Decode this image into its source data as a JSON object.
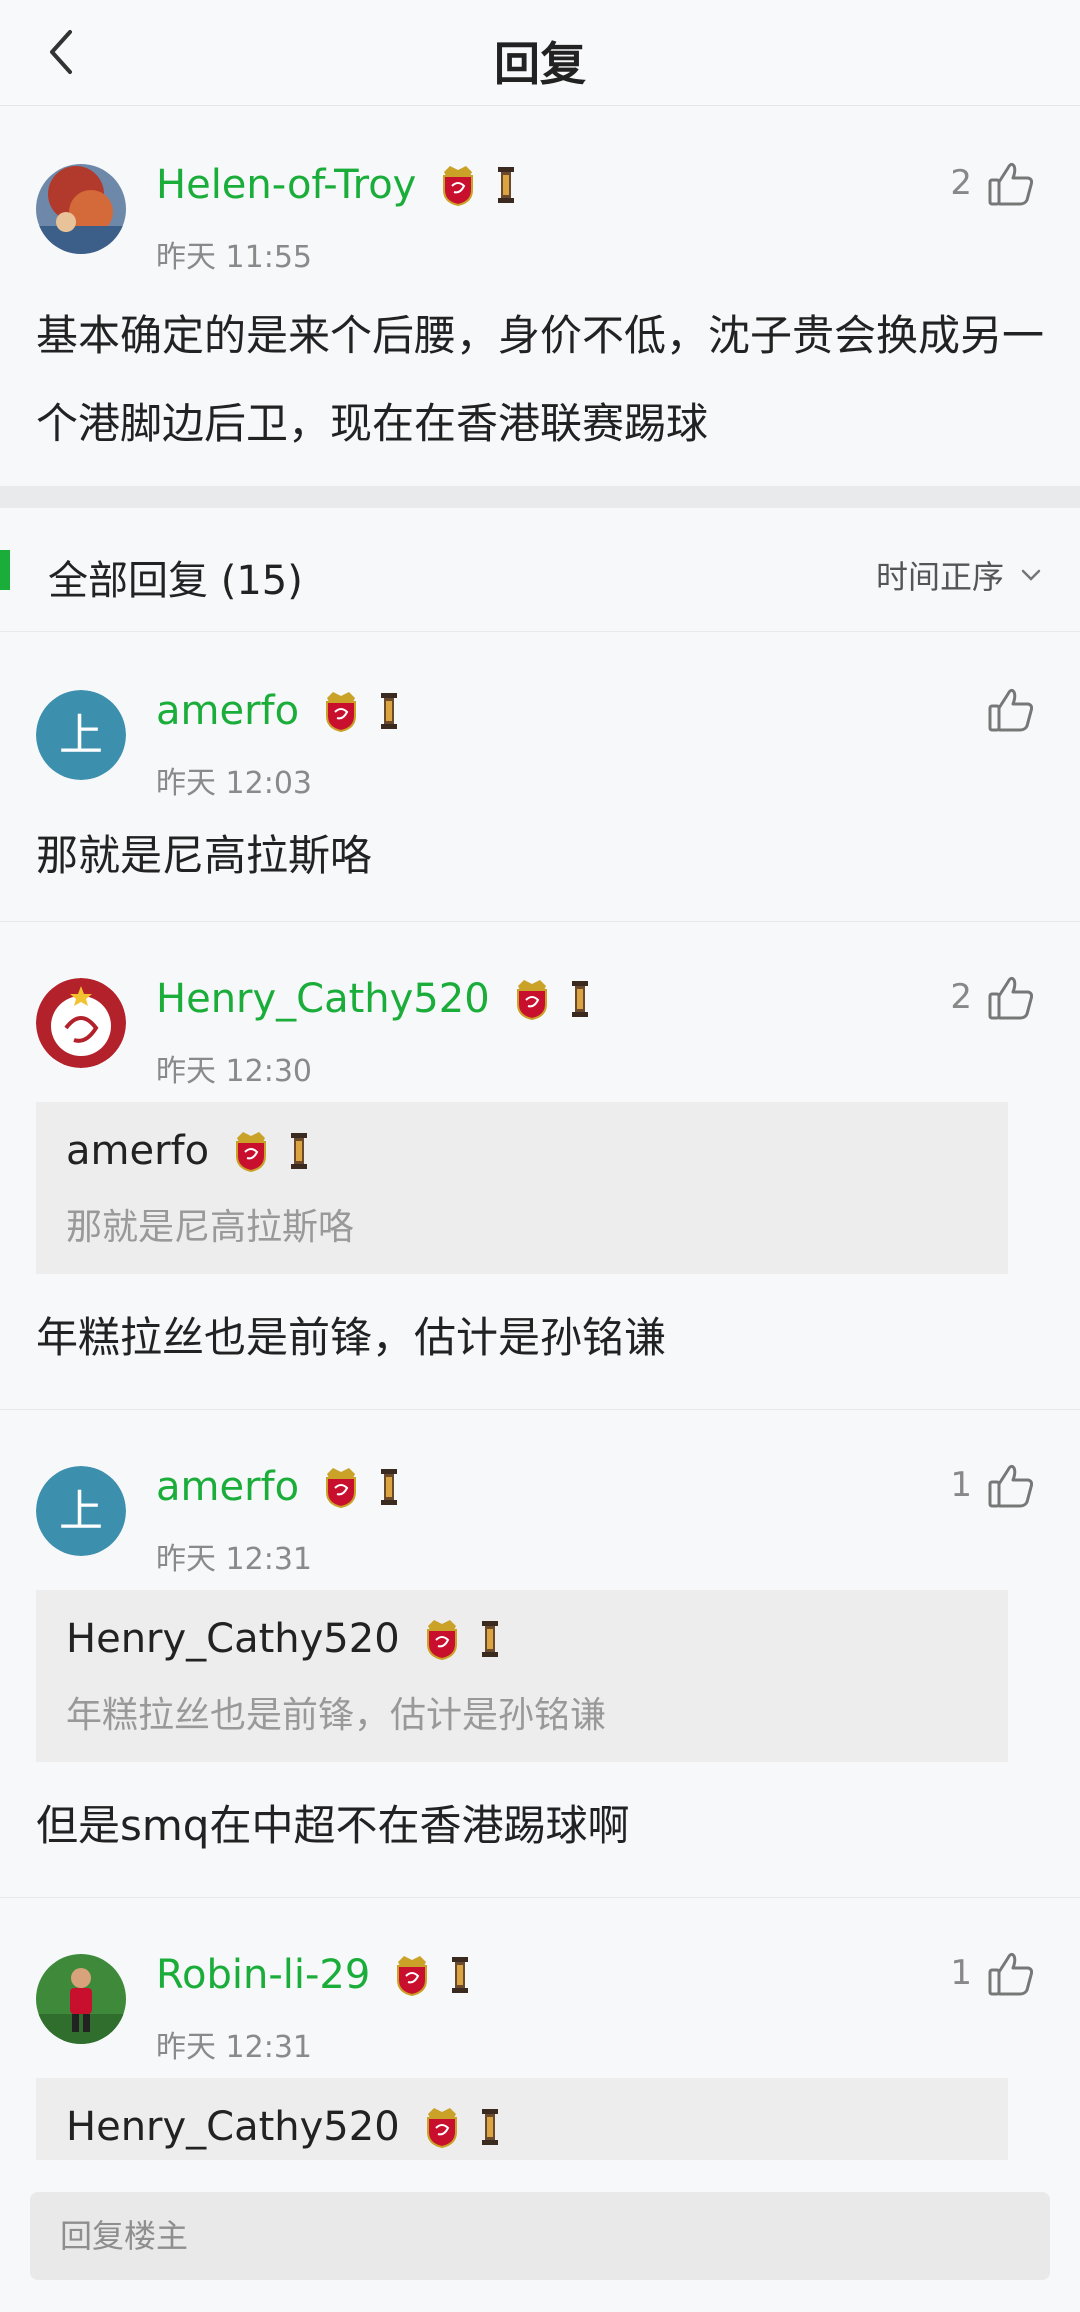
{
  "header": {
    "title": "回复"
  },
  "post": {
    "username": "Helen-of-Troy",
    "time": "昨天 11:55",
    "likes": "2",
    "content": "基本确定的是来个后腰，身价不低，沈子贵会换成另一个港脚边后卫，现在在香港联赛踢球"
  },
  "replies_header": {
    "title": "全部回复 (15)",
    "sort_label": "时间正序"
  },
  "replies": [
    {
      "username": "amerfo",
      "avatar_text": "上",
      "time": "昨天 12:03",
      "likes": "",
      "content": "那就是尼高拉斯咯"
    },
    {
      "username": "Henry_Cathy520",
      "time": "昨天 12:30",
      "likes": "2",
      "quote": {
        "username": "amerfo",
        "text": "那就是尼高拉斯咯"
      },
      "content": "年糕拉丝也是前锋，估计是孙铭谦"
    },
    {
      "username": "amerfo",
      "avatar_text": "上",
      "time": "昨天 12:31",
      "likes": "1",
      "quote": {
        "username": "Henry_Cathy520",
        "text": "年糕拉丝也是前锋，估计是孙铭谦"
      },
      "content": "但是smq在中超不在香港踢球啊"
    },
    {
      "username": "Robin-li-29",
      "time": "昨天 12:31",
      "likes": "1",
      "quote": {
        "username": "Henry_Cathy520"
      }
    }
  ],
  "footer": {
    "placeholder": "回复楼主"
  },
  "colors": {
    "accent_green": "#1aad3a",
    "avatar_blue": "#3d8fae"
  },
  "icons": [
    "back-arrow-icon",
    "thumbs-up-icon",
    "chevron-down-icon",
    "club-badge-icon",
    "tower-badge-icon"
  ]
}
